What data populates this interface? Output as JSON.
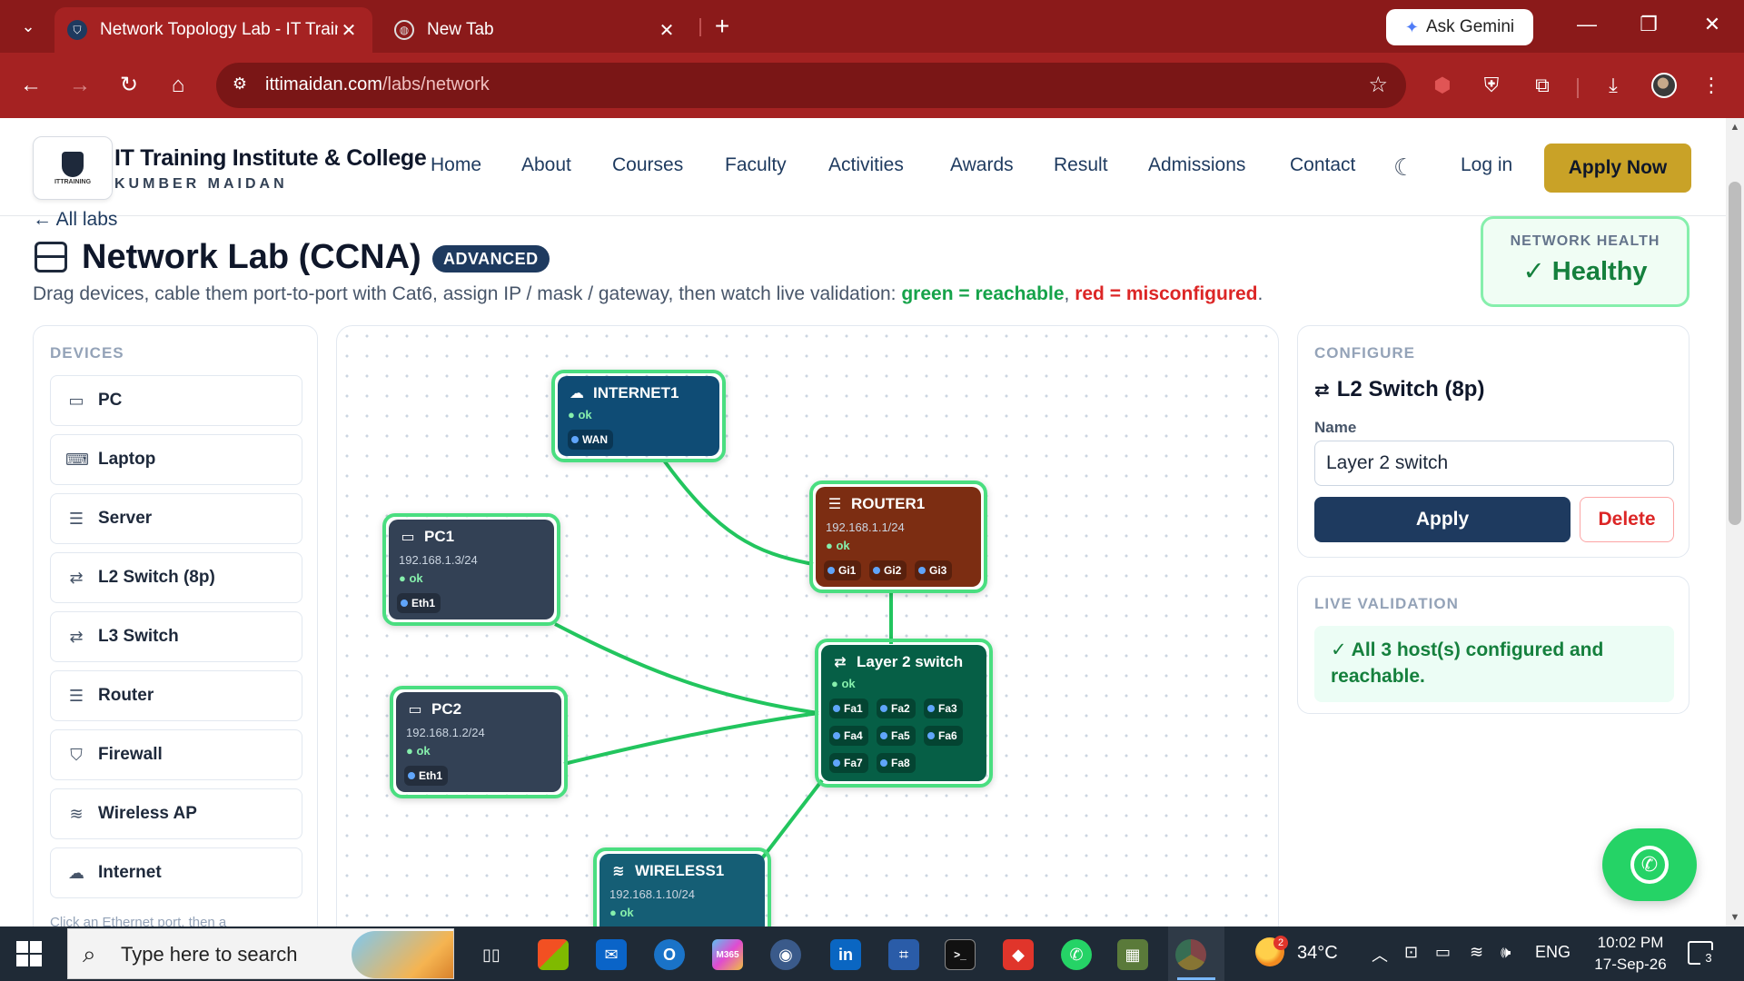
{
  "browser": {
    "tabs": [
      {
        "title": "Network Topology Lab - IT Training",
        "active": true
      },
      {
        "title": "New Tab",
        "active": false
      }
    ],
    "gemini_label": "Ask Gemini",
    "url_host": "ittimaidan.com",
    "url_path": "/labs/network"
  },
  "site": {
    "logo_text": "ITTRAINING",
    "brand_title": "IT Training Institute & College",
    "brand_subtitle": "KUMBER MAIDAN",
    "nav": [
      "Home",
      "About",
      "Courses",
      "Faculty",
      "Activities",
      "Awards",
      "Result",
      "Admissions",
      "Contact"
    ],
    "login_label": "Log in",
    "apply_label": "Apply Now",
    "brand_gold": "#c9a227",
    "brand_navy": "#1e3a5f"
  },
  "lab": {
    "back_label": "← All labs",
    "title": "Network Lab (CCNA)",
    "level": "ADVANCED",
    "desc_main": "Drag devices, cable them port-to-port with Cat6, assign IP / mask / gateway, then watch live validation: ",
    "desc_ok": "green = reachable",
    "desc_sep": ", ",
    "desc_bad": "red = misconfigured",
    "desc_end": ".",
    "health_label": "NETWORK HEALTH",
    "health_value": "✓ Healthy"
  },
  "devices": {
    "heading": "DEVICES",
    "items": [
      {
        "label": "PC",
        "icon": "monitor-icon"
      },
      {
        "label": "Laptop",
        "icon": "laptop-icon"
      },
      {
        "label": "Server",
        "icon": "server-icon"
      },
      {
        "label": "L2 Switch (8p)",
        "icon": "switch-icon"
      },
      {
        "label": "L3 Switch",
        "icon": "switch-icon"
      },
      {
        "label": "Router",
        "icon": "router-icon"
      },
      {
        "label": "Firewall",
        "icon": "shield-icon"
      },
      {
        "label": "Wireless AP",
        "icon": "wifi-icon"
      },
      {
        "label": "Internet",
        "icon": "cloud-icon"
      }
    ],
    "hint": "Click an Ethernet port, then a"
  },
  "topology": {
    "status_text": "● ok",
    "nodes": {
      "internet1": {
        "name": "INTERNET1",
        "ports": [
          "WAN"
        ],
        "color": "#0f4c75"
      },
      "router1": {
        "name": "ROUTER1",
        "ip": "192.168.1.1/24",
        "ports": [
          "Gi1",
          "Gi2",
          "Gi3"
        ],
        "color": "#7c2d12"
      },
      "pc1": {
        "name": "PC1",
        "ip": "192.168.1.3/24",
        "ports": [
          "Eth1"
        ],
        "color": "#334155"
      },
      "pc2": {
        "name": "PC2",
        "ip": "192.168.1.2/24",
        "ports": [
          "Eth1"
        ],
        "color": "#334155"
      },
      "switch": {
        "name": "Layer 2 switch",
        "ports": [
          "Fa1",
          "Fa2",
          "Fa3",
          "Fa4",
          "Fa5",
          "Fa6",
          "Fa7",
          "Fa8"
        ],
        "color": "#065f46"
      },
      "wireless1": {
        "name": "WIRELESS1",
        "ip": "192.168.1.10/24",
        "color": "#155e75"
      }
    },
    "link_color": "#22c55e"
  },
  "configure": {
    "heading": "CONFIGURE",
    "title": "L2 Switch (8p)",
    "name_label": "Name",
    "name_value": "Layer 2 switch",
    "apply_label": "Apply",
    "delete_label": "Delete"
  },
  "validation": {
    "heading": "LIVE VALIDATION",
    "message": "✓ All 3 host(s) configured and reachable."
  },
  "taskbar": {
    "search_placeholder": "Type here to search",
    "temperature": "34°C",
    "language": "ENG",
    "time": "10:02 PM",
    "date": "17-Sep-26",
    "notifications": "3",
    "weather_badge": "2"
  }
}
